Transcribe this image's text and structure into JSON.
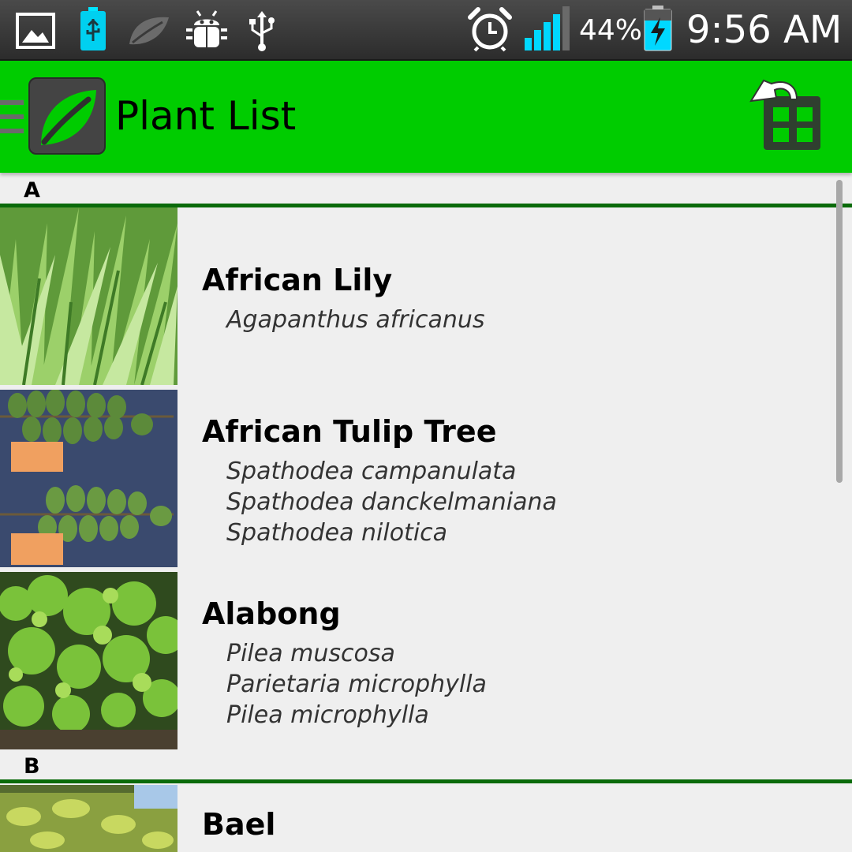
{
  "status_bar": {
    "icons": [
      "image-icon",
      "usb-battery-icon",
      "leaf-icon",
      "android-debug-icon",
      "usb-icon",
      "alarm-icon",
      "signal-icon",
      "battery-charging-icon"
    ],
    "battery_percent": "44%",
    "time": "9:56 AM"
  },
  "action_bar": {
    "title": "Plant List",
    "colors": {
      "bar": "#00cc00",
      "divider": "#0a6a0a"
    }
  },
  "sections": [
    {
      "letter": "A",
      "plants": [
        {
          "common": "African Lily",
          "scientific": [
            "Agapanthus africanus"
          ]
        },
        {
          "common": "African Tulip Tree",
          "scientific": [
            "Spathodea campanulata",
            "Spathodea danckelmaniana",
            "Spathodea nilotica"
          ]
        },
        {
          "common": "Alabong",
          "scientific": [
            "Pilea muscosa",
            "Parietaria microphylla",
            "Pilea microphylla"
          ]
        }
      ]
    },
    {
      "letter": "B",
      "plants": [
        {
          "common": "Bael",
          "scientific": []
        }
      ]
    }
  ]
}
